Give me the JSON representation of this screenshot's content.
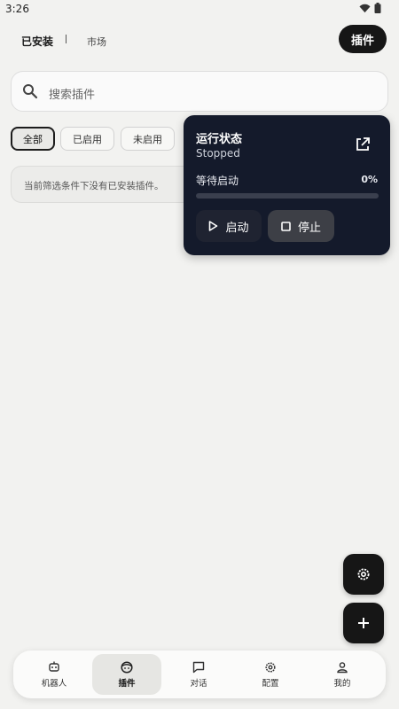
{
  "status_bar": {
    "time": "3:26",
    "icons": [
      "wifi-icon",
      "battery-icon"
    ]
  },
  "top_tabs": {
    "installed": "已安装",
    "market": "市场"
  },
  "header": {
    "plugin_button": "插件"
  },
  "search": {
    "placeholder": "搜索插件",
    "icon": "search-icon"
  },
  "filters": [
    "全部",
    "已启用",
    "未启用"
  ],
  "filters_active_index": 0,
  "empty_message": "当前筛选条件下没有已安装插件。",
  "status_panel": {
    "title": "运行状态",
    "state": "Stopped",
    "progress_label": "等待启动",
    "progress_percent": "0%",
    "progress_value": 0,
    "start_label": "启动",
    "stop_label": "停止"
  },
  "bottom_nav": [
    {
      "label": "机器人",
      "icon": "robot-icon"
    },
    {
      "label": "插件",
      "icon": "face-icon"
    },
    {
      "label": "对话",
      "icon": "chat-icon"
    },
    {
      "label": "配置",
      "icon": "gear-icon"
    },
    {
      "label": "我的",
      "icon": "person-icon"
    }
  ],
  "bottom_nav_active_index": 1,
  "colors": {
    "background": "#f2f2f0",
    "dark": "#161616",
    "panel": "#141a2b"
  }
}
